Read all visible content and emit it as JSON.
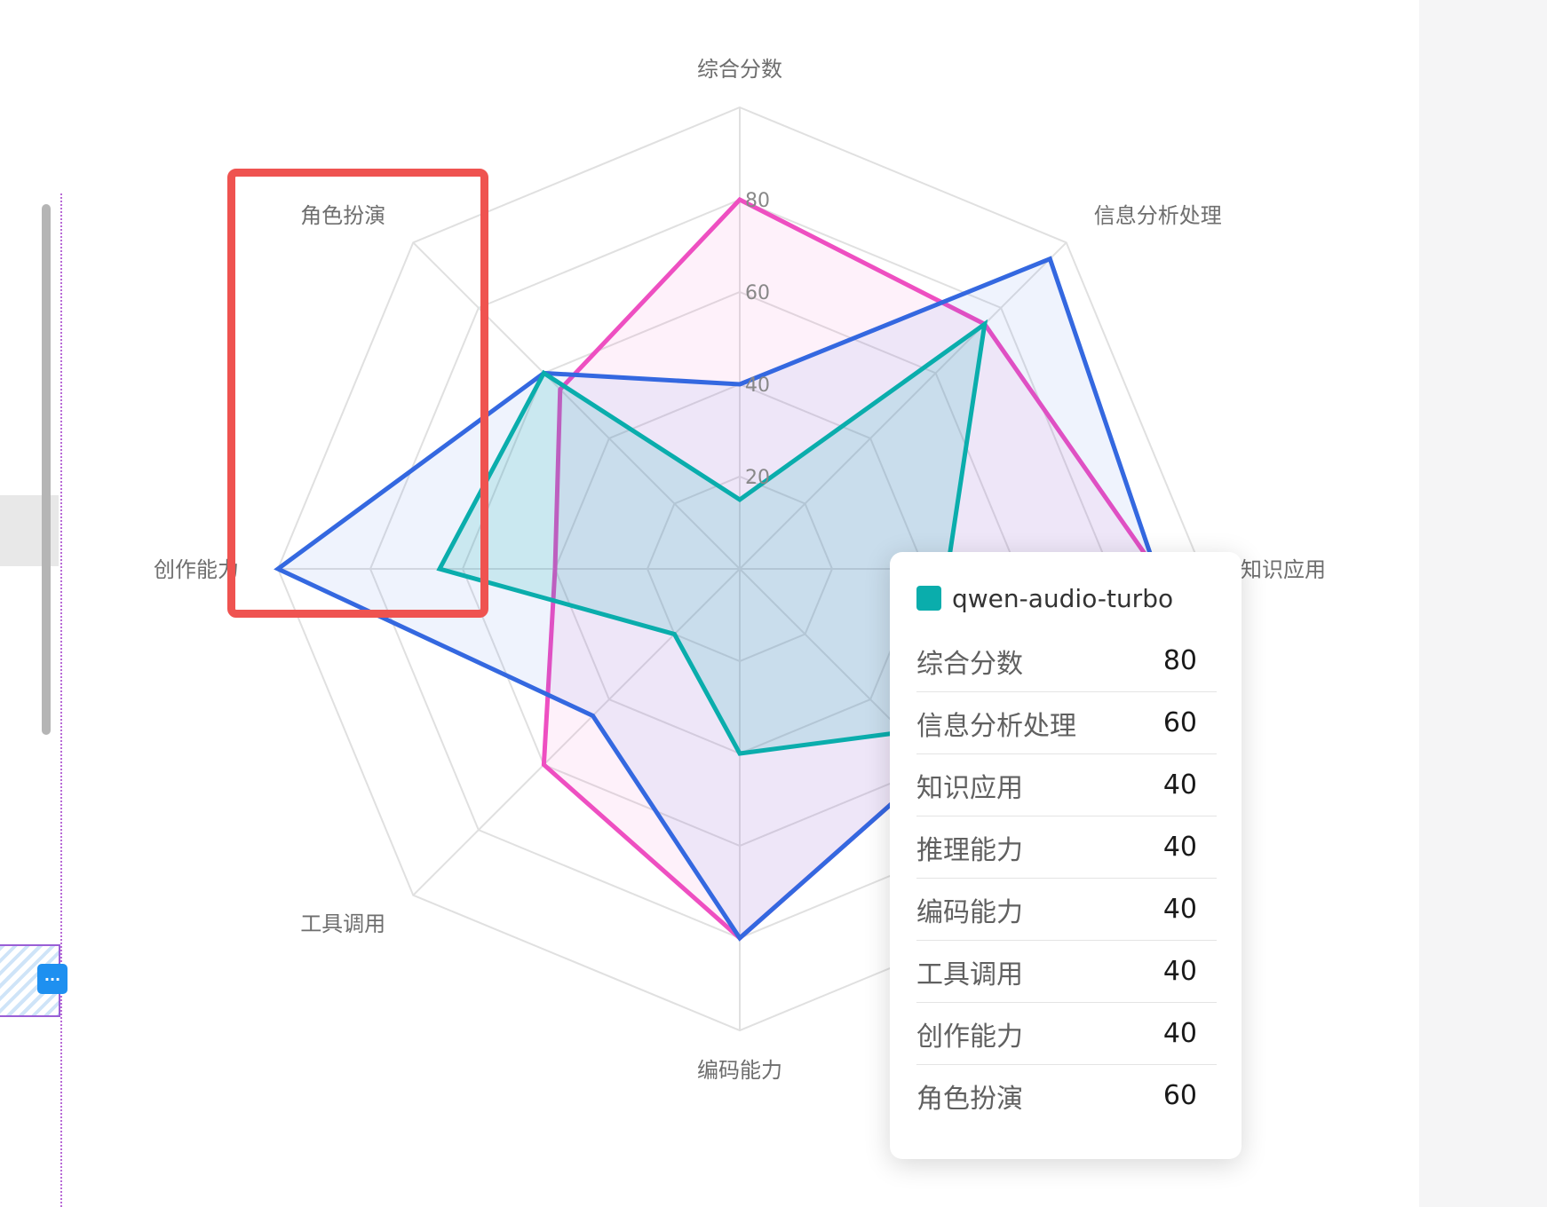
{
  "chart_data": {
    "type": "radar",
    "indicators": [
      "综合分数",
      "信息分析处理",
      "知识应用",
      "推理能力",
      "编码能力",
      "工具调用",
      "创作能力",
      "角色扮演"
    ],
    "max": 100,
    "ticks": [
      "20",
      "40",
      "60",
      "80"
    ],
    "series": [
      {
        "color": "#ee4fc1",
        "values": [
          80,
          75,
          90,
          60,
          80,
          60,
          40,
          55
        ]
      },
      {
        "color": "#3468e0",
        "values": [
          40,
          95,
          90,
          60,
          80,
          45,
          100,
          60
        ]
      },
      {
        "name": "qwen-audio-turbo",
        "color": "#0aadac",
        "values": [
          15,
          75,
          45,
          50,
          40,
          20,
          65,
          60
        ]
      }
    ]
  },
  "tooltip": {
    "series_name": "qwen-audio-turbo",
    "swatch_color": "#0aadac",
    "rows": [
      {
        "label": "综合分数",
        "value": "80"
      },
      {
        "label": "信息分析处理",
        "value": "60"
      },
      {
        "label": "知识应用",
        "value": "40"
      },
      {
        "label": "推理能力",
        "value": "40"
      },
      {
        "label": "编码能力",
        "value": "40"
      },
      {
        "label": "工具调用",
        "value": "40"
      },
      {
        "label": "创作能力",
        "value": "40"
      },
      {
        "label": "角色扮演",
        "value": "60"
      }
    ]
  },
  "editor": {
    "more_button_label": "..."
  },
  "colors": {
    "highlight_box": "#ef5350",
    "grid": "#e0e0e0"
  }
}
